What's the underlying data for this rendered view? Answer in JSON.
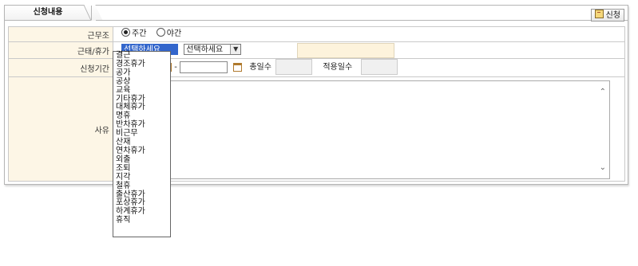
{
  "tab": {
    "label": "신청내용"
  },
  "apply_button": {
    "label": "신청"
  },
  "rows": {
    "shift": {
      "label": "근무조",
      "options": [
        "주간",
        "야간"
      ],
      "selected": "주간"
    },
    "leave": {
      "label": "근태/휴가",
      "select1_value": "선택하세요",
      "select2_value": "선택하세요"
    },
    "period": {
      "label": "신청기간",
      "dash": "-",
      "total_days_label": "총일수",
      "applied_days_label": "적용일수"
    },
    "reason": {
      "label": "사유"
    }
  },
  "dropdown": {
    "items": [
      "결근",
      "경조휴가",
      "공가",
      "공상",
      "교육",
      "기타휴가",
      "대체휴가",
      "명휴",
      "반차휴가",
      "비근무",
      "산재",
      "연차휴가",
      "외출",
      "조퇴",
      "지각",
      "철휴",
      "출산휴가",
      "포상휴가",
      "하계휴가",
      "휴직"
    ]
  }
}
